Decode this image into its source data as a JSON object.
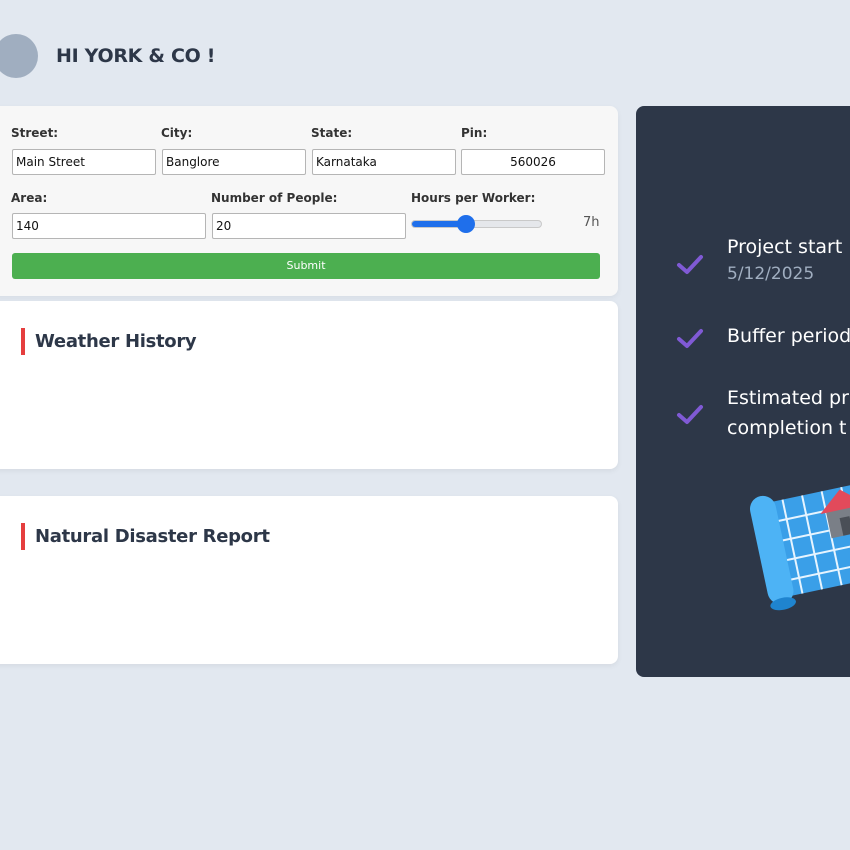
{
  "header": {
    "greeting": "HI YORK & CO !"
  },
  "form": {
    "street_label": "Street:",
    "street_value": "Main Street",
    "city_label": "City:",
    "city_value": "Banglore",
    "state_label": "State:",
    "state_value": "Karnataka",
    "pin_label": "Pin:",
    "pin_value": "560026",
    "area_label": "Area:",
    "area_value": "140",
    "people_label": "Number of People:",
    "people_value": "20",
    "hours_label": "Hours per Worker:",
    "hours_display": "7h",
    "hours_fraction": 0.42,
    "submit_label": "Submit"
  },
  "sections": {
    "weather_title": "Weather History",
    "disaster_title": "Natural Disaster Report"
  },
  "timeline": {
    "project_start_title": "Project start",
    "project_start_date": "5/12/2025",
    "buffer_title": "Buffer period",
    "estimated_line1": "Estimated pr",
    "estimated_line2": "completion t"
  },
  "colors": {
    "accent_red": "#e53e3e",
    "submit_green": "#4caf50",
    "slider_blue": "#1f6feb",
    "check_purple": "#805ad5",
    "panel_dark": "#2d3748"
  },
  "icons": [
    "avatar",
    "check-icon",
    "blueprint-house-icon"
  ]
}
